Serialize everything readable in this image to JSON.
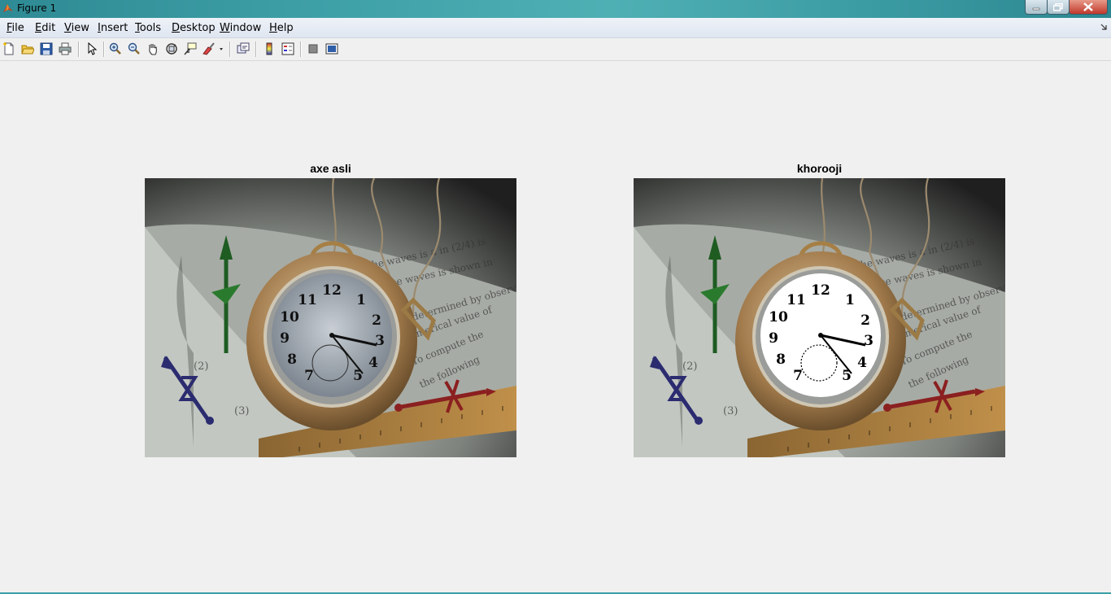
{
  "window": {
    "title": "Figure 1",
    "title_icon": "matlab-logo-icon",
    "controls": [
      "minimize-icon",
      "maximize-icon",
      "close-icon"
    ]
  },
  "menubar": {
    "items": [
      {
        "accel": "F",
        "rest": "ile"
      },
      {
        "accel": "E",
        "rest": "dit"
      },
      {
        "accel": "V",
        "rest": "iew"
      },
      {
        "accel": "I",
        "rest": "nsert"
      },
      {
        "accel": "T",
        "rest": "ools"
      },
      {
        "accel": "D",
        "rest": "esktop"
      },
      {
        "accel": "W",
        "rest": "indow"
      },
      {
        "accel": "H",
        "rest": "elp"
      }
    ]
  },
  "toolbar": {
    "icons": [
      "new-figure-icon",
      "open-file-icon",
      "save-icon",
      "print-icon",
      "edit-plot-arrow-icon",
      "zoom-in-icon",
      "zoom-out-icon",
      "pan-hand-icon",
      "rotate-3d-icon",
      "data-cursor-icon",
      "brush-icon",
      "link-plot-icon",
      "colorbar-icon",
      "legend-icon",
      "hide-plot-tools-icon",
      "show-plot-tools-icon"
    ]
  },
  "axes": [
    {
      "title": "axe asli",
      "image": "pocket-watch-original"
    },
    {
      "title": "khorooji",
      "image": "pocket-watch-enhanced"
    }
  ],
  "colors": {
    "titlebar": "#3fa1a8",
    "menubar": "#e8edf5",
    "figure_bg": "#f0f0f0"
  }
}
